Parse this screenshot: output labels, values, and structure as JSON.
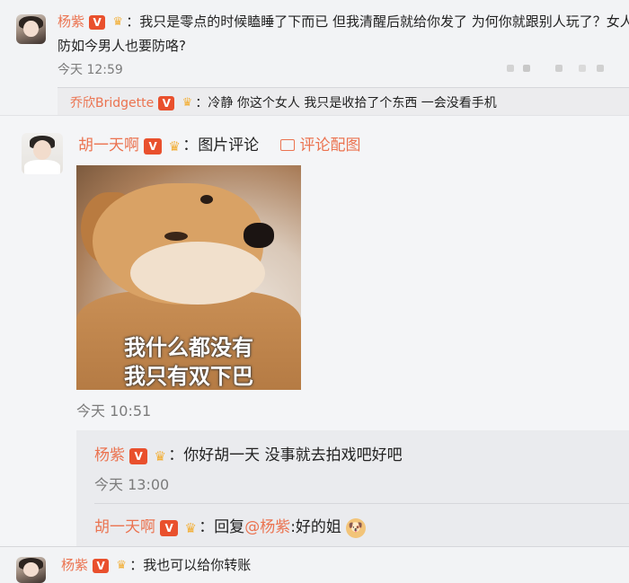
{
  "comment1": {
    "user": "杨紫",
    "badge": "V",
    "crown": "♛",
    "text_line1": "我只是零点的时候瞌睡了下而已 但我清醒后就给你发了 为何你就跟别人玩了？女人",
    "text_line2": "防如今男人也要防咯?",
    "time": "今天 12:59",
    "reply": {
      "user": "乔欣Bridgette",
      "badge": "V",
      "crown": "♛",
      "text": "冷静 你这个女人 我只是收拾了个东西  一会没看手机"
    }
  },
  "comment2": {
    "user": "胡一天啊",
    "badge": "V",
    "crown": "♛",
    "text": "图片评论",
    "pic_link": "评论配图",
    "meme_caption_line1": "我什么都没有",
    "meme_caption_line2": "我只有双下巴",
    "time": "今天 10:51",
    "replies": [
      {
        "user": "杨紫",
        "badge": "V",
        "crown": "♛",
        "text": "你好胡一天 没事就去拍戏吧好吧",
        "time": "今天 13:00"
      },
      {
        "user": "胡一天啊",
        "badge": "V",
        "crown": "♛",
        "reply_prefix": "回复",
        "mention": "@杨紫",
        "text": ":好的姐",
        "emoji": "🐶"
      }
    ]
  },
  "comment3": {
    "user": "杨紫",
    "badge": "V",
    "crown": "♛",
    "text": "我也可以给你转账"
  },
  "separator": "："
}
